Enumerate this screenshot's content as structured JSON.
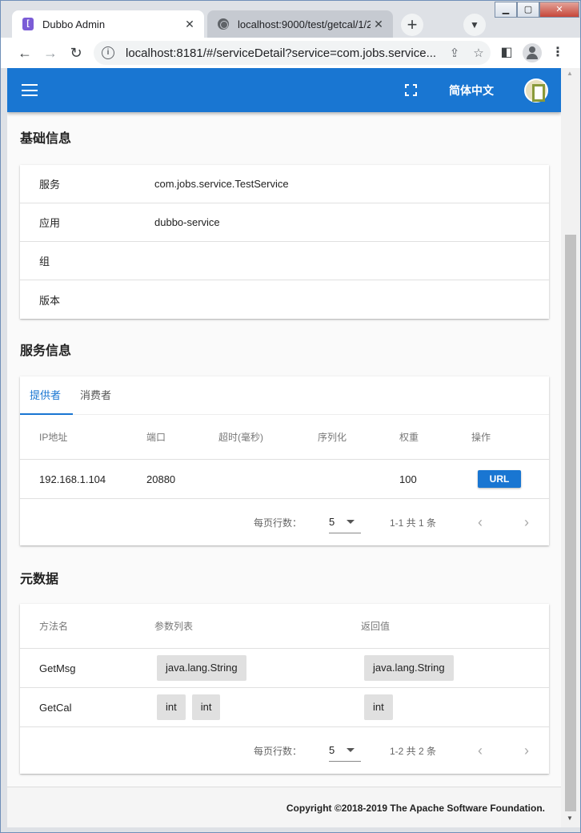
{
  "browser": {
    "tabs": [
      {
        "title": "Dubbo Admin",
        "icon": "dubbo-favicon",
        "active": true
      },
      {
        "title": "localhost:9000/test/getcal/1/2",
        "icon": "globe-icon",
        "active": false
      }
    ],
    "url": "localhost:8181/#/serviceDetail?service=com.jobs.service..."
  },
  "appbar": {
    "language": "简体中文"
  },
  "basic_info": {
    "title": "基础信息",
    "rows": [
      {
        "label": "服务",
        "value": "com.jobs.service.TestService"
      },
      {
        "label": "应用",
        "value": "dubbo-service"
      },
      {
        "label": "组",
        "value": ""
      },
      {
        "label": "版本",
        "value": ""
      }
    ]
  },
  "service_info": {
    "title": "服务信息",
    "tabs": [
      "提供者",
      "消费者"
    ],
    "columns": [
      "IP地址",
      "端口",
      "超时(毫秒)",
      "序列化",
      "权重",
      "操作"
    ],
    "rows": [
      {
        "ip": "192.168.1.104",
        "port": "20880",
        "timeout": "",
        "serialization": "",
        "weight": "100",
        "action": "URL"
      }
    ],
    "pagination": {
      "rows_per_page_label": "每页行数：",
      "rows_per_page": "5",
      "range": "1-1 共 1 条"
    }
  },
  "metadata": {
    "title": "元数据",
    "columns": [
      "方法名",
      "参数列表",
      "返回值"
    ],
    "rows": [
      {
        "method": "GetMsg",
        "params": [
          "java.lang.String"
        ],
        "returns": "java.lang.String"
      },
      {
        "method": "GetCal",
        "params": [
          "int",
          "int"
        ],
        "returns": "int"
      }
    ],
    "pagination": {
      "rows_per_page_label": "每页行数：",
      "rows_per_page": "5",
      "range": "1-2 共 2 条"
    }
  },
  "footer": {
    "copyright": "Copyright ©2018-2019 The Apache Software Foundation."
  },
  "colors": {
    "primary": "#1976d2",
    "chip": "#e0e0e0"
  }
}
